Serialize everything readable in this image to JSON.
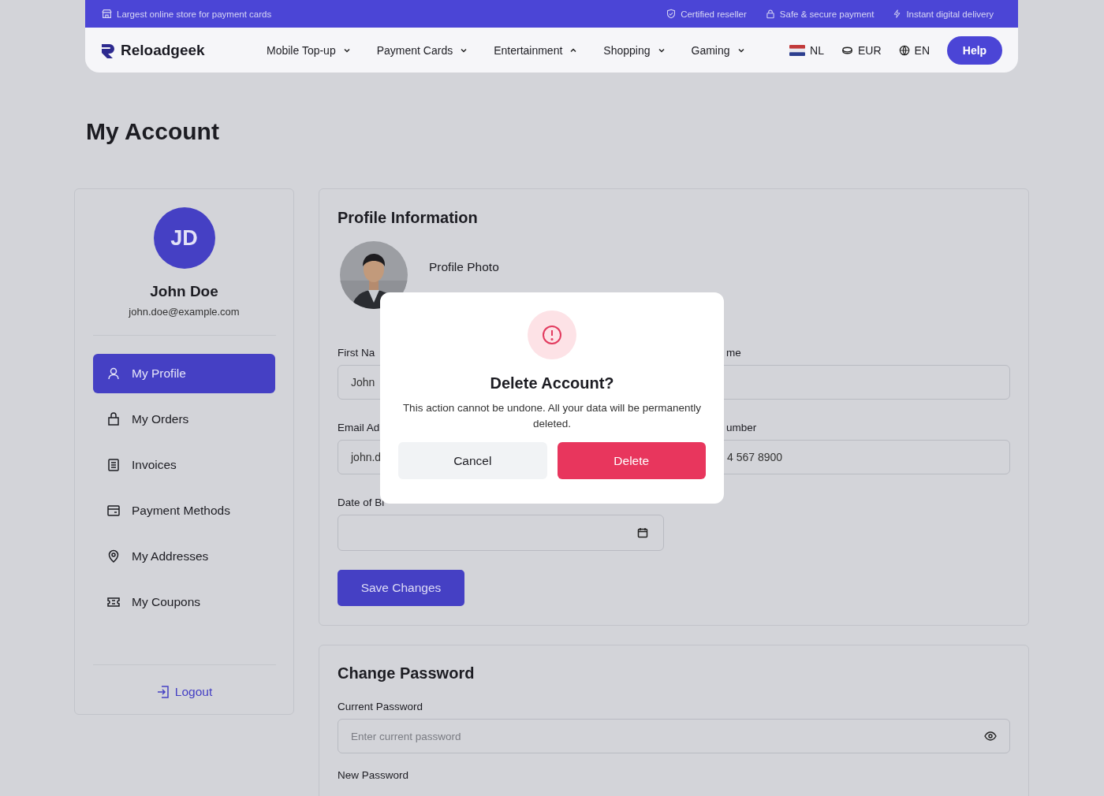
{
  "topbar": {
    "tagline": "Largest online store for payment cards",
    "badges": [
      {
        "kind": "shield",
        "label": "Certified reseller"
      },
      {
        "kind": "lock",
        "label": "Safe & secure payment"
      },
      {
        "kind": "bolt",
        "label": "Instant digital delivery"
      }
    ]
  },
  "header": {
    "logo": "Reloadgeek",
    "menu": [
      {
        "label": "Mobile Top-up",
        "expanded": false
      },
      {
        "label": "Payment Cards",
        "expanded": false
      },
      {
        "label": "Entertainment",
        "expanded": true
      },
      {
        "label": "Shopping",
        "expanded": false
      },
      {
        "label": "Gaming",
        "expanded": false
      }
    ],
    "region": "NL",
    "currency": "EUR",
    "language": "EN",
    "help": "Help"
  },
  "page_title": "My Account",
  "sidebar": {
    "initials": "JD",
    "name": "John Doe",
    "email": "john.doe@example.com",
    "items": [
      {
        "label": "My Profile",
        "kind": "user",
        "selected": true
      },
      {
        "label": "My Orders",
        "kind": "bag",
        "selected": false
      },
      {
        "label": "Invoices",
        "kind": "list",
        "selected": false
      },
      {
        "label": "Payment Methods",
        "kind": "card",
        "selected": false
      },
      {
        "label": "My Addresses",
        "kind": "pin",
        "selected": false
      },
      {
        "label": "My Coupons",
        "kind": "ticket",
        "selected": false
      }
    ],
    "logout": "Logout"
  },
  "profile": {
    "title": "Profile Information",
    "photo": {
      "kind": "picture",
      "label": "Profile Photo"
    },
    "first_name": {
      "label": "First Na",
      "value": "John"
    },
    "last_name": {
      "label": "me"
    },
    "email": {
      "label": "Email Ad",
      "value": "john.d"
    },
    "phone": {
      "label": "umber",
      "value": "4 567 8900"
    },
    "birth_date": {
      "label": "Date of Bi"
    },
    "save": "Save Changes"
  },
  "change_password": {
    "title": "Change Password",
    "current": {
      "label": "Current Password",
      "placeholder": "Enter current password"
    },
    "new_label": "New Password"
  },
  "dialog": {
    "title": "Delete Account?",
    "message": "This action cannot be undone. All your data will be permanently deleted.",
    "cancel": "Cancel",
    "confirm": "Delete"
  }
}
